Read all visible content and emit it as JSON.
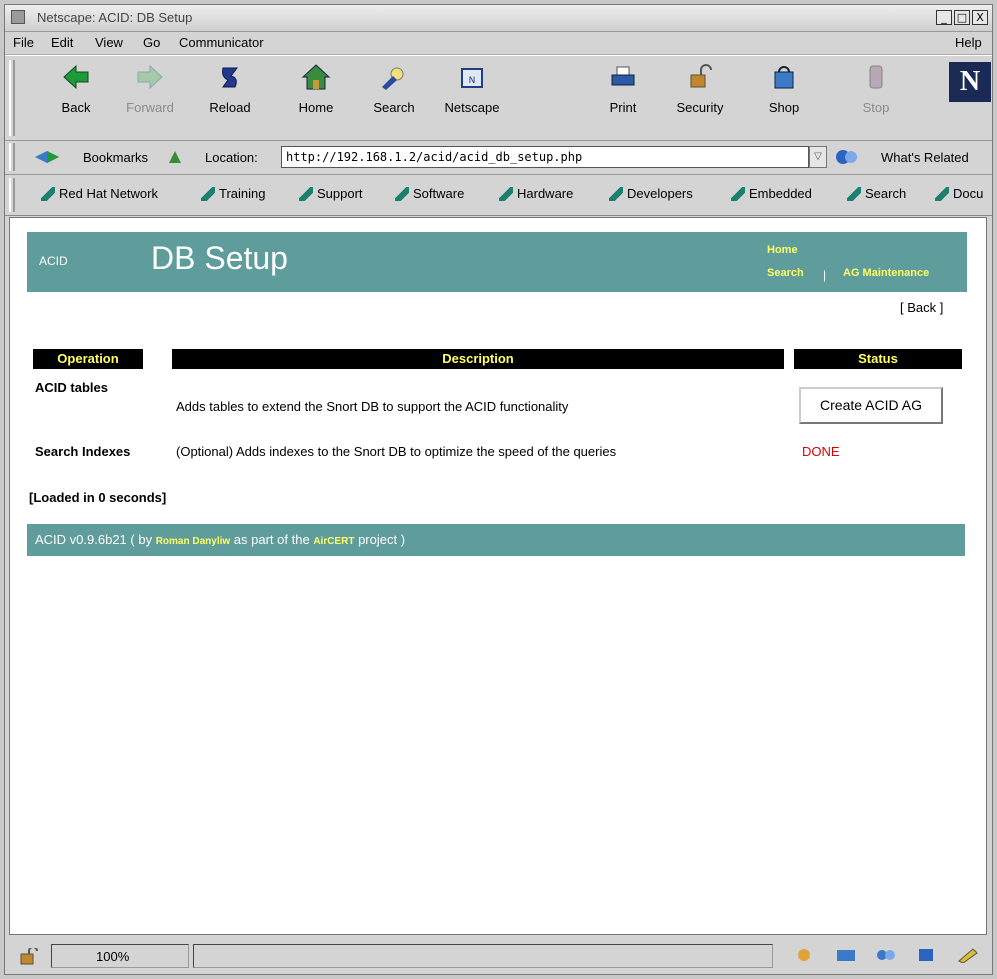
{
  "window": {
    "title": "Netscape: ACID: DB Setup",
    "controls": [
      "_",
      "□",
      "X"
    ]
  },
  "menu": {
    "items": [
      "File",
      "Edit",
      "View",
      "Go",
      "Communicator"
    ],
    "help": "Help"
  },
  "toolbar": {
    "back": "Back",
    "forward": "Forward",
    "reload": "Reload",
    "home": "Home",
    "search": "Search",
    "netscape": "Netscape",
    "print": "Print",
    "security": "Security",
    "shop": "Shop",
    "stop": "Stop",
    "logo": "N"
  },
  "location": {
    "bookmarks": "Bookmarks",
    "label": "Location:",
    "url": "http://192.168.1.2/acid/acid_db_setup.php",
    "whats_related": "What's Related"
  },
  "personal_bar": [
    "Red Hat Network",
    "Training",
    "Support",
    "Software",
    "Hardware",
    "Developers",
    "Embedded",
    "Search",
    "Docu"
  ],
  "page": {
    "acid_label": "ACID",
    "title": "DB Setup",
    "links": {
      "home": "Home",
      "search": "Search",
      "separator": "|",
      "ag_maintenance": "AG Maintenance"
    },
    "back": "[ Back ]",
    "table": {
      "headers": [
        "Operation",
        "Description",
        "Status"
      ],
      "rows": [
        {
          "operation": "ACID tables",
          "description": "Adds tables to extend the Snort DB to support the ACID functionality",
          "status_button": "Create ACID AG"
        },
        {
          "operation": "Search Indexes",
          "description": "(Optional) Adds indexes to the Snort DB to optimize the speed of the queries",
          "status": "DONE"
        }
      ]
    },
    "loaded": "[Loaded in 0 seconds]",
    "footer": {
      "version": "ACID v0.9.6b21",
      "by": "( by",
      "author": "Roman Danyliw",
      "part_of": "as part of the",
      "project_name": "AirCERT",
      "project_end": "project )"
    }
  },
  "status_bar": {
    "zoom": "100%"
  },
  "colors": {
    "header_teal": "#5f9c9c",
    "link_yellow": "#ffff66",
    "done_red": "#dd0000"
  }
}
